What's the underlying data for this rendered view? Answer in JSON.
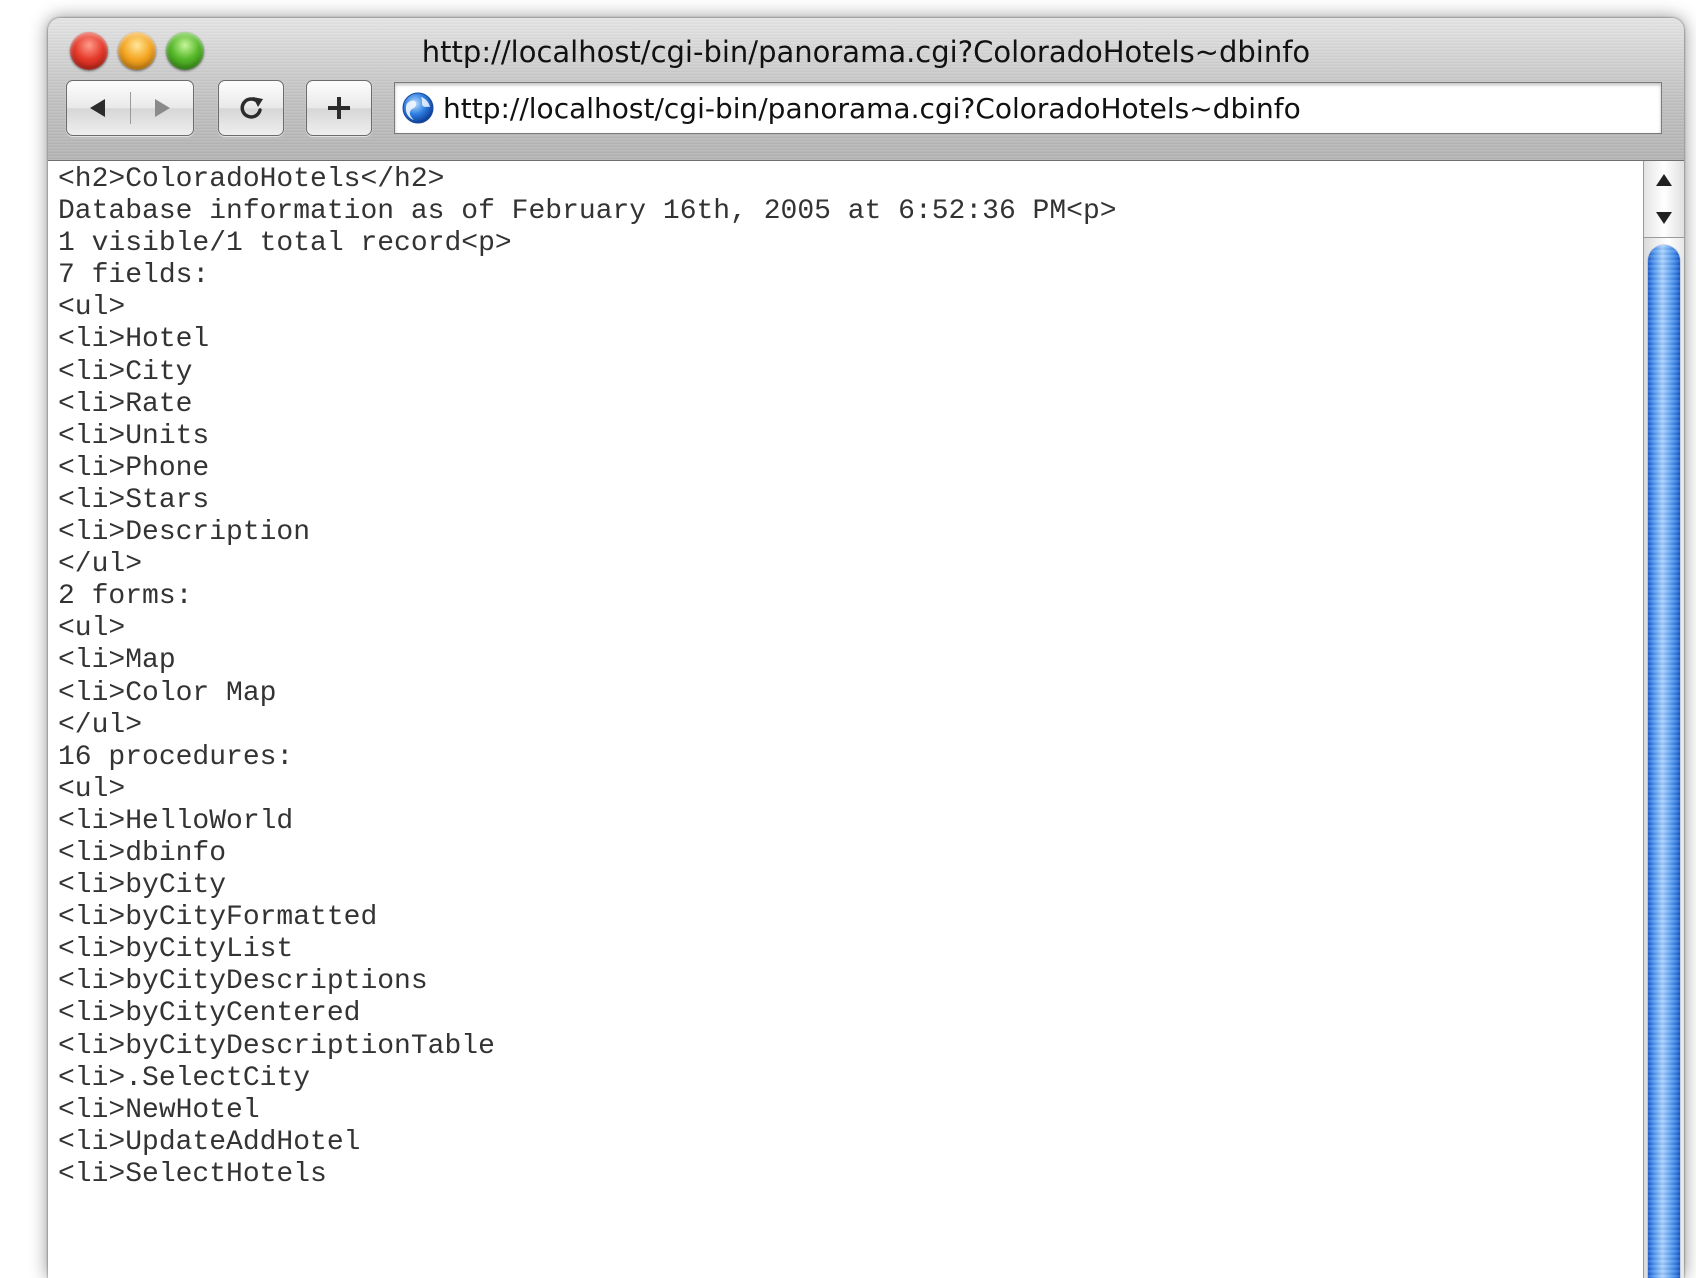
{
  "window": {
    "title": "http://localhost/cgi-bin/panorama.cgi?ColoradoHotels~dbinfo"
  },
  "toolbar": {
    "back_icon": "back-arrow-icon",
    "forward_icon": "forward-arrow-icon",
    "reload_icon": "reload-icon",
    "add_bookmark_icon": "plus-icon",
    "url": "http://localhost/cgi-bin/panorama.cgi?ColoradoHotels~dbinfo"
  },
  "source_lines": [
    "<h2>ColoradoHotels</h2>",
    "Database information as of February 16th, 2005 at 6:52:36 PM<p>",
    "1 visible/1 total record<p>",
    "7 fields:",
    "<ul>",
    "<li>Hotel",
    "<li>City",
    "<li>Rate",
    "<li>Units",
    "<li>Phone",
    "<li>Stars",
    "<li>Description",
    "</ul>",
    "2 forms:",
    "<ul>",
    "<li>Map",
    "<li>Color Map",
    "</ul>",
    "16 procedures:",
    "<ul>",
    "<li>HelloWorld",
    "<li>dbinfo",
    "<li>byCity",
    "<li>byCityFormatted",
    "<li>byCityList",
    "<li>byCityDescriptions",
    "<li>byCityCentered",
    "<li>byCityDescriptionTable",
    "<li>.SelectCity",
    "<li>NewHotel",
    "<li>UpdateAddHotel",
    "<li>SelectHotels"
  ]
}
